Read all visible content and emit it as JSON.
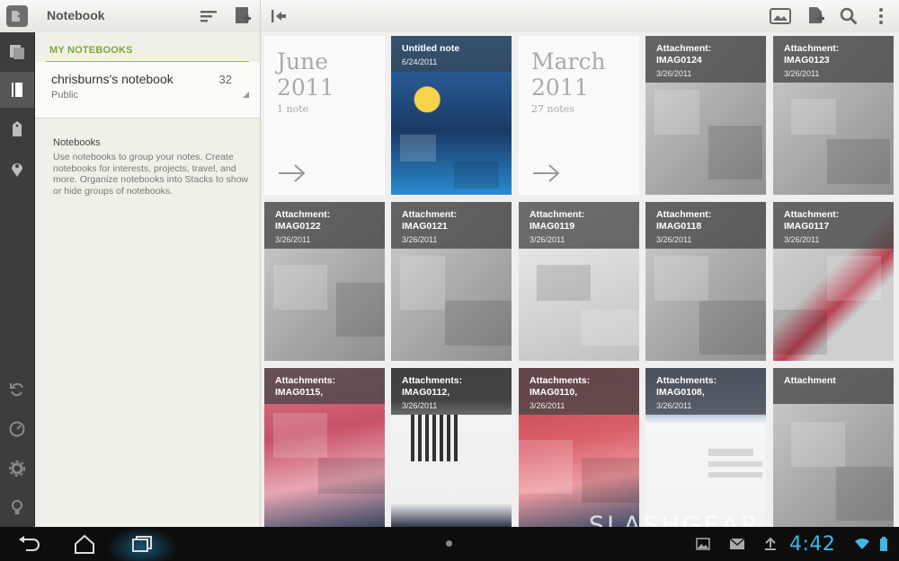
{
  "topbar": {
    "title": "Notebook"
  },
  "panel": {
    "heading": "MY NOTEBOOKS",
    "notebook": {
      "name": "chrisburns's notebook",
      "visibility": "Public",
      "count": "32"
    },
    "help_title": "Notebooks",
    "help_body": "Use notebooks to group your notes. Create notebooks for interests, projects, travel, and more. Organize notebooks into Stacks to show or hide groups of notebooks."
  },
  "months": [
    {
      "name": "June",
      "year": "2011",
      "count": "1 note"
    },
    {
      "name": "March",
      "year": "2011",
      "count": "27 notes"
    }
  ],
  "tiles": [
    {
      "title": "Untitled note",
      "date": "6/24/2011"
    },
    {
      "title": "Attachment:\nIMAG0124",
      "date": "3/26/2011"
    },
    {
      "title": "Attachment:\nIMAG0123",
      "date": "3/26/2011"
    },
    {
      "title": "Attachment:\nIMAG0122",
      "date": "3/26/2011"
    },
    {
      "title": "Attachment:\nIMAG0121",
      "date": "3/26/2011"
    },
    {
      "title": "Attachment:\nIMAG0119",
      "date": "3/26/2011"
    },
    {
      "title": "Attachment:\nIMAG0118",
      "date": "3/26/2011"
    },
    {
      "title": "Attachment:\nIMAG0117",
      "date": "3/26/2011"
    },
    {
      "title": "Attachments:\nIMAG0115,",
      "date": ""
    },
    {
      "title": "Attachments:\nIMAG0112,",
      "date": "3/26/2011"
    },
    {
      "title": "Attachments:\nIMAG0110,",
      "date": "3/26/2011"
    },
    {
      "title": "Attachments:\nIMAG0108,",
      "date": "3/26/2011"
    },
    {
      "title": "Attachment",
      "date": ""
    }
  ],
  "status": {
    "time": "4:42"
  },
  "watermark": "SLASHGEAR",
  "colors": {
    "accent_green": "#79a83c",
    "clock_blue": "#3fb7e6"
  }
}
